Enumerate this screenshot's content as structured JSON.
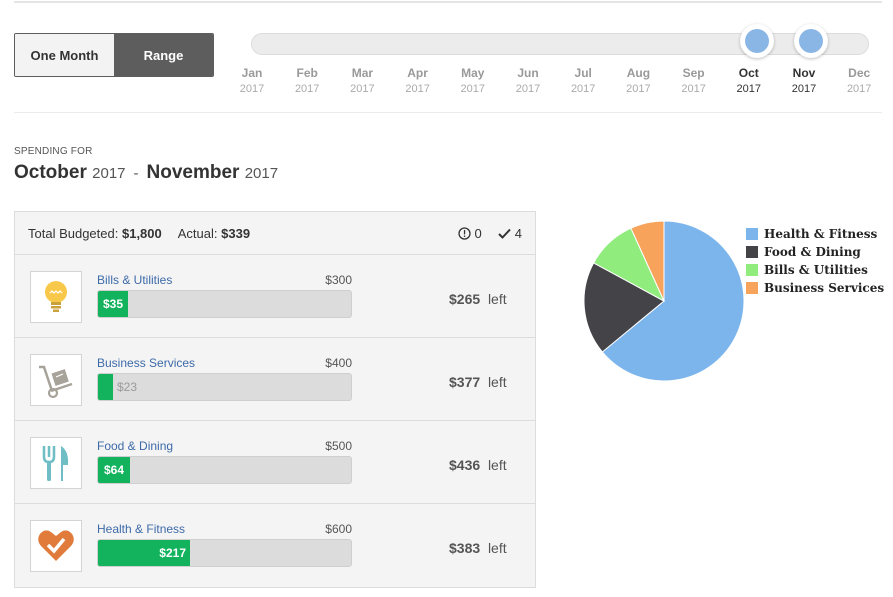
{
  "toggle": {
    "one_month": "One Month",
    "range": "Range"
  },
  "slider": {
    "months": [
      {
        "m": "Jan",
        "y": "2017"
      },
      {
        "m": "Feb",
        "y": "2017"
      },
      {
        "m": "Mar",
        "y": "2017"
      },
      {
        "m": "Apr",
        "y": "2017"
      },
      {
        "m": "May",
        "y": "2017"
      },
      {
        "m": "Jun",
        "y": "2017"
      },
      {
        "m": "Jul",
        "y": "2017"
      },
      {
        "m": "Aug",
        "y": "2017"
      },
      {
        "m": "Sep",
        "y": "2017"
      },
      {
        "m": "Oct",
        "y": "2017"
      },
      {
        "m": "Nov",
        "y": "2017"
      },
      {
        "m": "Dec",
        "y": "2017"
      }
    ],
    "selected_start": "Oct",
    "selected_end": "Nov",
    "knob_color": "#8ab6e6"
  },
  "spending": {
    "label": "SPENDING FOR",
    "from_month": "October",
    "from_year": "2017",
    "dash": "-",
    "to_month": "November",
    "to_year": "2017"
  },
  "summary": {
    "total_label": "Total Budgeted:",
    "total_value": "$1,800",
    "actual_label": "Actual:",
    "actual_value": "$339",
    "alerts_count": "0",
    "checks_count": "4"
  },
  "categories": [
    {
      "name": "Bills & Utilities",
      "budget": "$300",
      "spent": "$35",
      "fraction": 0.117,
      "remaining": "$265",
      "left_word": "left",
      "icon": "lightbulb-icon"
    },
    {
      "name": "Business Services",
      "budget": "$400",
      "spent": "$23",
      "fraction": 0.058,
      "remaining": "$377",
      "left_word": "left",
      "icon": "hand-truck-icon"
    },
    {
      "name": "Food & Dining",
      "budget": "$500",
      "spent": "$64",
      "fraction": 0.128,
      "remaining": "$436",
      "left_word": "left",
      "icon": "fork-knife-icon"
    },
    {
      "name": "Health & Fitness",
      "budget": "$600",
      "spent": "$217",
      "fraction": 0.362,
      "remaining": "$383",
      "left_word": "left",
      "icon": "heart-check-icon"
    }
  ],
  "colors": {
    "bar_fill": "#13b35e",
    "link": "#3d6aa8"
  },
  "chart_data": {
    "type": "pie",
    "slices": [
      {
        "label": "Health & Fitness",
        "value": 217,
        "color": "#7cb5ec"
      },
      {
        "label": "Food & Dining",
        "value": 64,
        "color": "#434348"
      },
      {
        "label": "Bills & Utilities",
        "value": 35,
        "color": "#90ed7d"
      },
      {
        "label": "Business Services",
        "value": 23,
        "color": "#f7a35c"
      }
    ],
    "legend_position": "right"
  }
}
